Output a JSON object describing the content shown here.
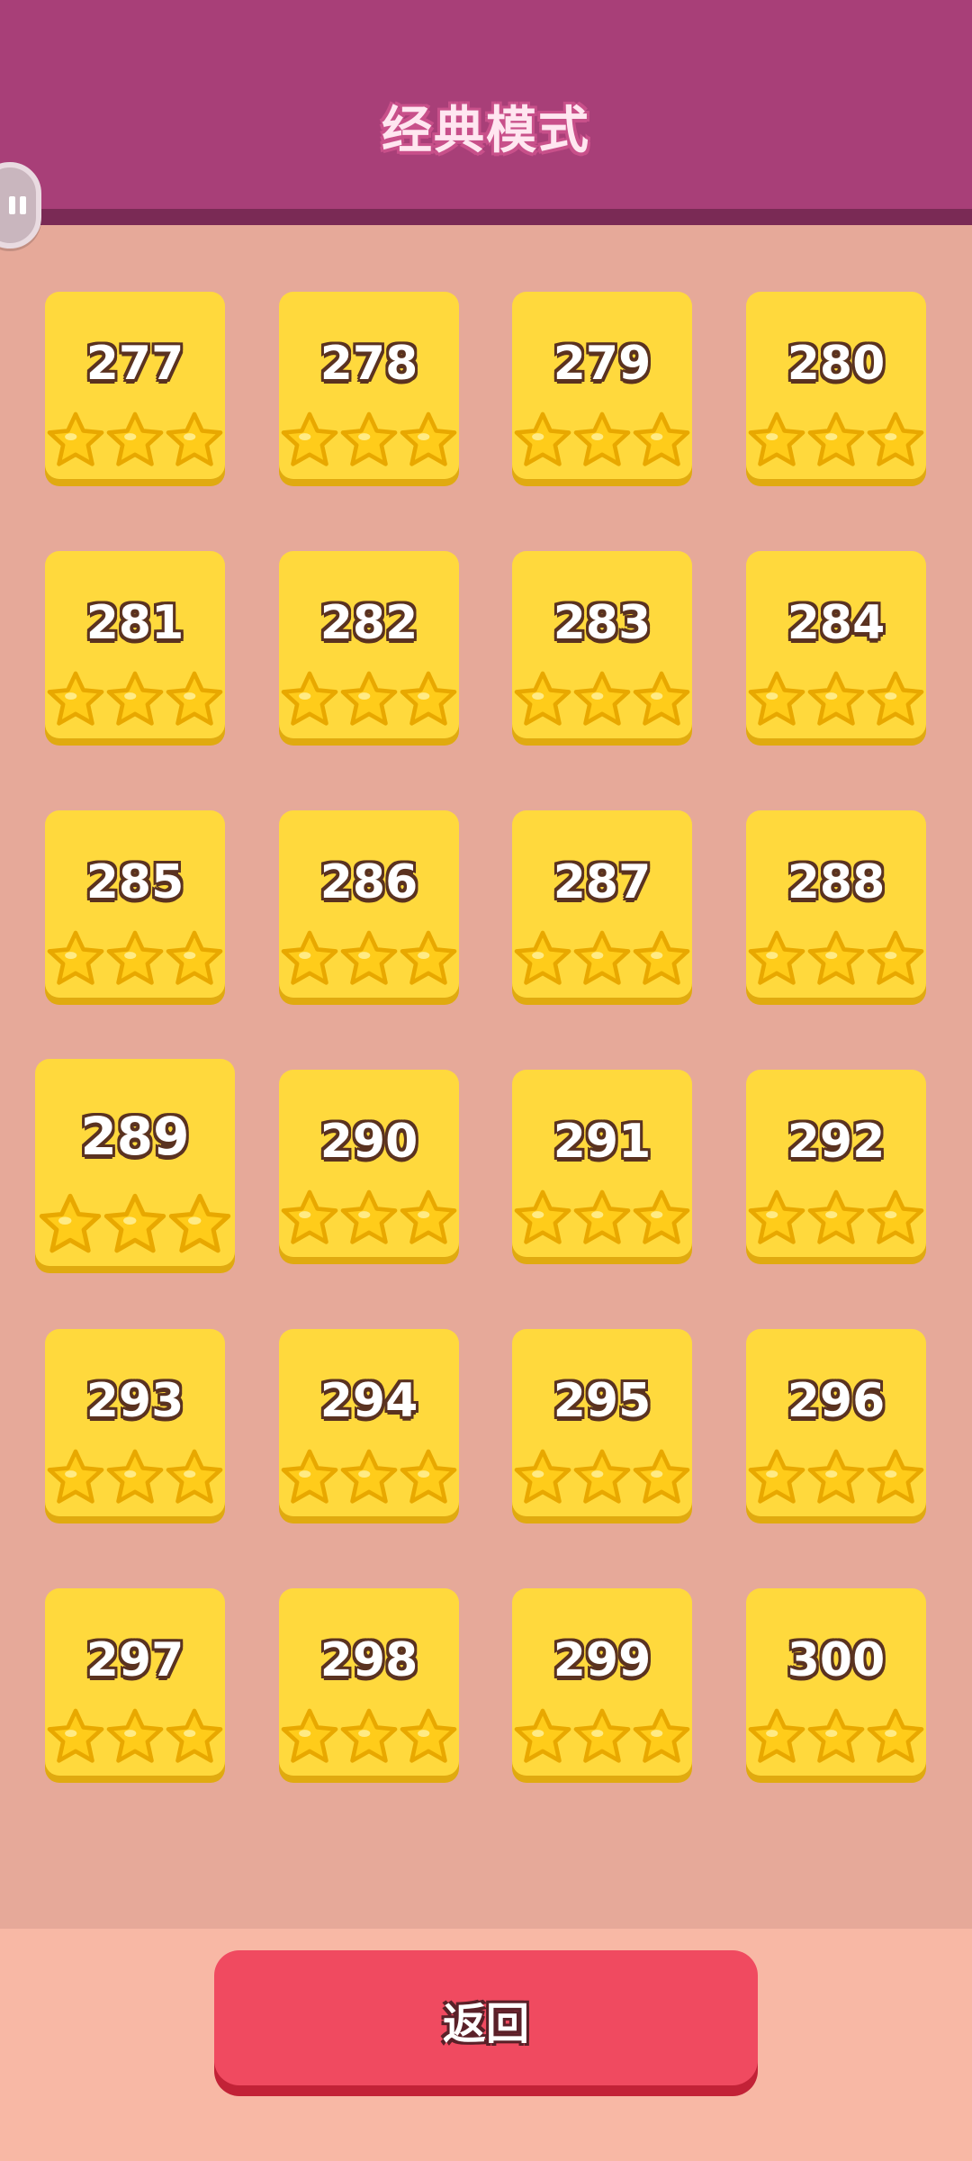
{
  "header": {
    "title": "经典模式"
  },
  "side_widget": {
    "icon": "pause-icon"
  },
  "levels": [
    {
      "number": "277",
      "stars": 3
    },
    {
      "number": "278",
      "stars": 3
    },
    {
      "number": "279",
      "stars": 3
    },
    {
      "number": "280",
      "stars": 3
    },
    {
      "number": "281",
      "stars": 3
    },
    {
      "number": "282",
      "stars": 3
    },
    {
      "number": "283",
      "stars": 3
    },
    {
      "number": "284",
      "stars": 3
    },
    {
      "number": "285",
      "stars": 3
    },
    {
      "number": "286",
      "stars": 3
    },
    {
      "number": "287",
      "stars": 3
    },
    {
      "number": "288",
      "stars": 3
    },
    {
      "number": "289",
      "stars": 3,
      "selected": true
    },
    {
      "number": "290",
      "stars": 3
    },
    {
      "number": "291",
      "stars": 3
    },
    {
      "number": "292",
      "stars": 3
    },
    {
      "number": "293",
      "stars": 3
    },
    {
      "number": "294",
      "stars": 3
    },
    {
      "number": "295",
      "stars": 3
    },
    {
      "number": "296",
      "stars": 3
    },
    {
      "number": "297",
      "stars": 3
    },
    {
      "number": "298",
      "stars": 3
    },
    {
      "number": "299",
      "stars": 3
    },
    {
      "number": "300",
      "stars": 3
    }
  ],
  "footer": {
    "back_label": "返回"
  },
  "colors": {
    "header_bg": "#a83f78",
    "page_bg": "#e6a999",
    "tile_bg": "#ffd93d",
    "button_bg": "#f04a60",
    "star": "#ffcc1a"
  }
}
